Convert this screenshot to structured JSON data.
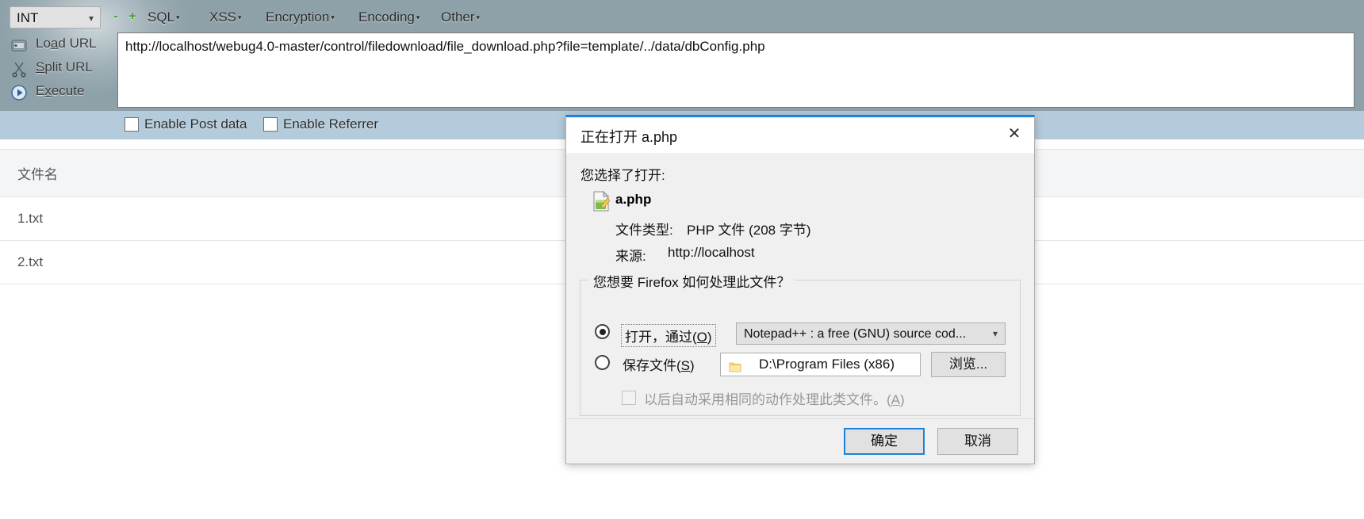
{
  "hackbar": {
    "type_select": {
      "value": "INT",
      "chevron": "chevron-down-icon"
    },
    "zoom_out": "-",
    "zoom_in": "+",
    "menus": [
      {
        "label": "SQL",
        "caret": "▾"
      },
      {
        "label": "XSS",
        "caret": "▾"
      },
      {
        "label": "Encryption",
        "caret": "▾"
      },
      {
        "label": "Encoding",
        "caret": "▾"
      },
      {
        "label": "Other",
        "caret": "▾"
      }
    ],
    "actions": [
      {
        "label_pre": "Lo",
        "accel": "a",
        "label_post": "d URL",
        "icon": "load-url-icon"
      },
      {
        "label_pre": "",
        "accel": "S",
        "label_post": "plit URL",
        "icon": "split-url-icon"
      },
      {
        "label_pre": "E",
        "accel": "x",
        "label_post": "ecute",
        "icon": "execute-icon"
      }
    ],
    "url": "http://localhost/webug4.0-master/control/filedownload/file_download.php?file=template/../data/dbConfig.php",
    "options": [
      {
        "label": "Enable Post data",
        "checked": false
      },
      {
        "label": "Enable Referrer",
        "checked": false
      }
    ]
  },
  "page": {
    "table": {
      "headers": [
        "文件名"
      ],
      "rows": [
        [
          "1.txt"
        ],
        [
          "2.txt"
        ]
      ]
    }
  },
  "dialog": {
    "title": "正在打开 a.php",
    "close_icon": "✕",
    "you_chose": "您选择了打开:",
    "file_icon": "php-file-icon",
    "file_name": "a.php",
    "file_type_label": "文件类型:",
    "file_type_value": "PHP 文件 (208 字节)",
    "source_label": "来源:",
    "source_value": "http://localhost",
    "legend": "您想要 Firefox 如何处理此文件？",
    "open_with": {
      "label_pre": "打开，通过(",
      "accel": "O",
      "label_post": ")",
      "selected": true,
      "app": "Notepad++ : a free (GNU) source cod...",
      "chevron": "⌄"
    },
    "save_file": {
      "label_pre": "保存文件(",
      "accel": "S",
      "label_post": ")",
      "selected": false,
      "path": "D:\\Program Files (x86)",
      "folder_icon": "folder-icon",
      "browse_label": "浏览..."
    },
    "auto_action": {
      "label_pre": "以后自动采用相同的动作处理此类文件。(",
      "accel": "A",
      "label_post": ")",
      "checked": false,
      "enabled": false
    },
    "ok_label": "确定",
    "cancel_label": "取消"
  },
  "colors": {
    "accent": "#1a82d8",
    "toolbar_option_bar": "#b4cbdc",
    "dialog_bg": "#f0f0f0"
  }
}
